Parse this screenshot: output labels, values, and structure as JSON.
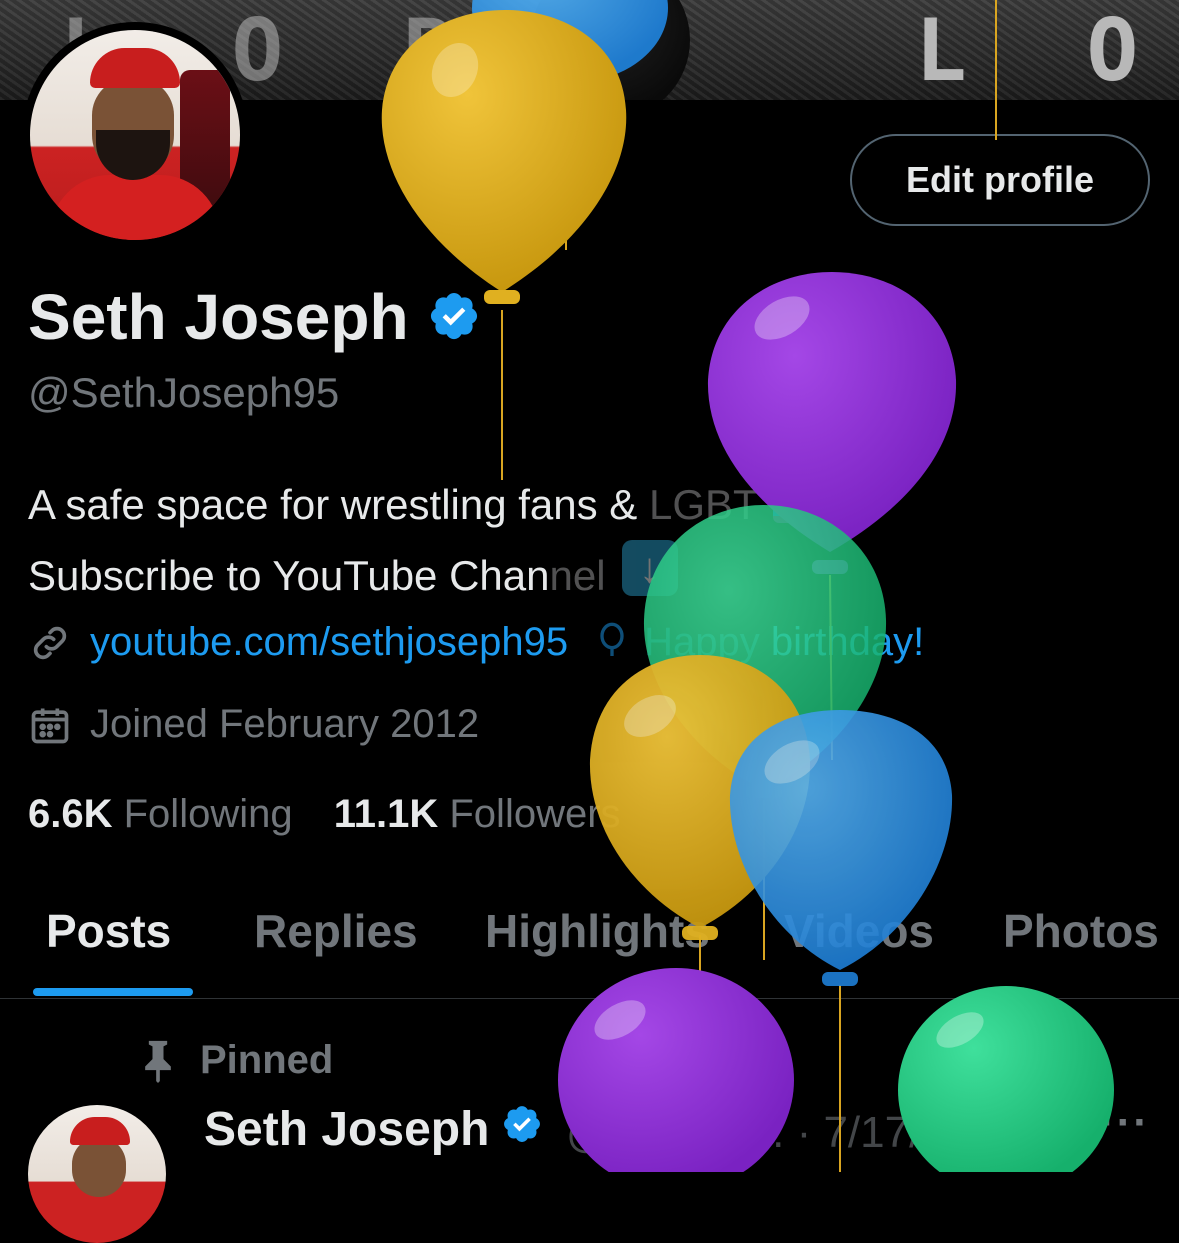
{
  "banner": {
    "letters_left": "L O R",
    "letters_right": "L O R"
  },
  "profile": {
    "name": "Seth Joseph",
    "handle": "@SethJoseph95",
    "bio_line1": "A safe space for wrestling fans & ",
    "bio_line1_faded": "LGBT",
    "bio_line2": "Subscribe to YouTube Chan",
    "bio_line2_faded": "nel",
    "link": "youtube.com/sethjoseph95",
    "birthday_faded": "Happy",
    "birthday": " birthday!",
    "joined": "Joined February 2012",
    "following_count": "6.6K",
    "following_label": "Following",
    "followers_count": "11.1K",
    "followers_label": "Followers"
  },
  "actions": {
    "edit_profile": "Edit profile"
  },
  "tabs": [
    {
      "label": "Posts",
      "active": true
    },
    {
      "label": "Replies",
      "active": false
    },
    {
      "label": "Highlights",
      "active": false
    },
    {
      "label": "Videos",
      "active": false
    },
    {
      "label": "Photos",
      "active": false
    }
  ],
  "pinned": {
    "label": "Pinned",
    "author": "Seth Joseph",
    "handle_truncated": "@SethJo...",
    "date": "· 7/17/25",
    "more": "···"
  },
  "colors": {
    "background": "#000000",
    "accent": "#1d9bf0",
    "secondary_text": "#71767b",
    "primary_text": "#e7e9ea",
    "verified": "#1d9bf0"
  },
  "icons": {
    "verified": "verified-badge-icon",
    "link": "link-icon",
    "birthday": "balloon-icon",
    "calendar": "calendar-icon",
    "pin": "pin-icon",
    "pride_flag": "rainbow-flag-emoji",
    "down_arrow": "down-arrow-emoji"
  },
  "balloon_colors": [
    "#d6a91a",
    "#2f8fe0",
    "#8a2fd0",
    "#23c57f"
  ]
}
